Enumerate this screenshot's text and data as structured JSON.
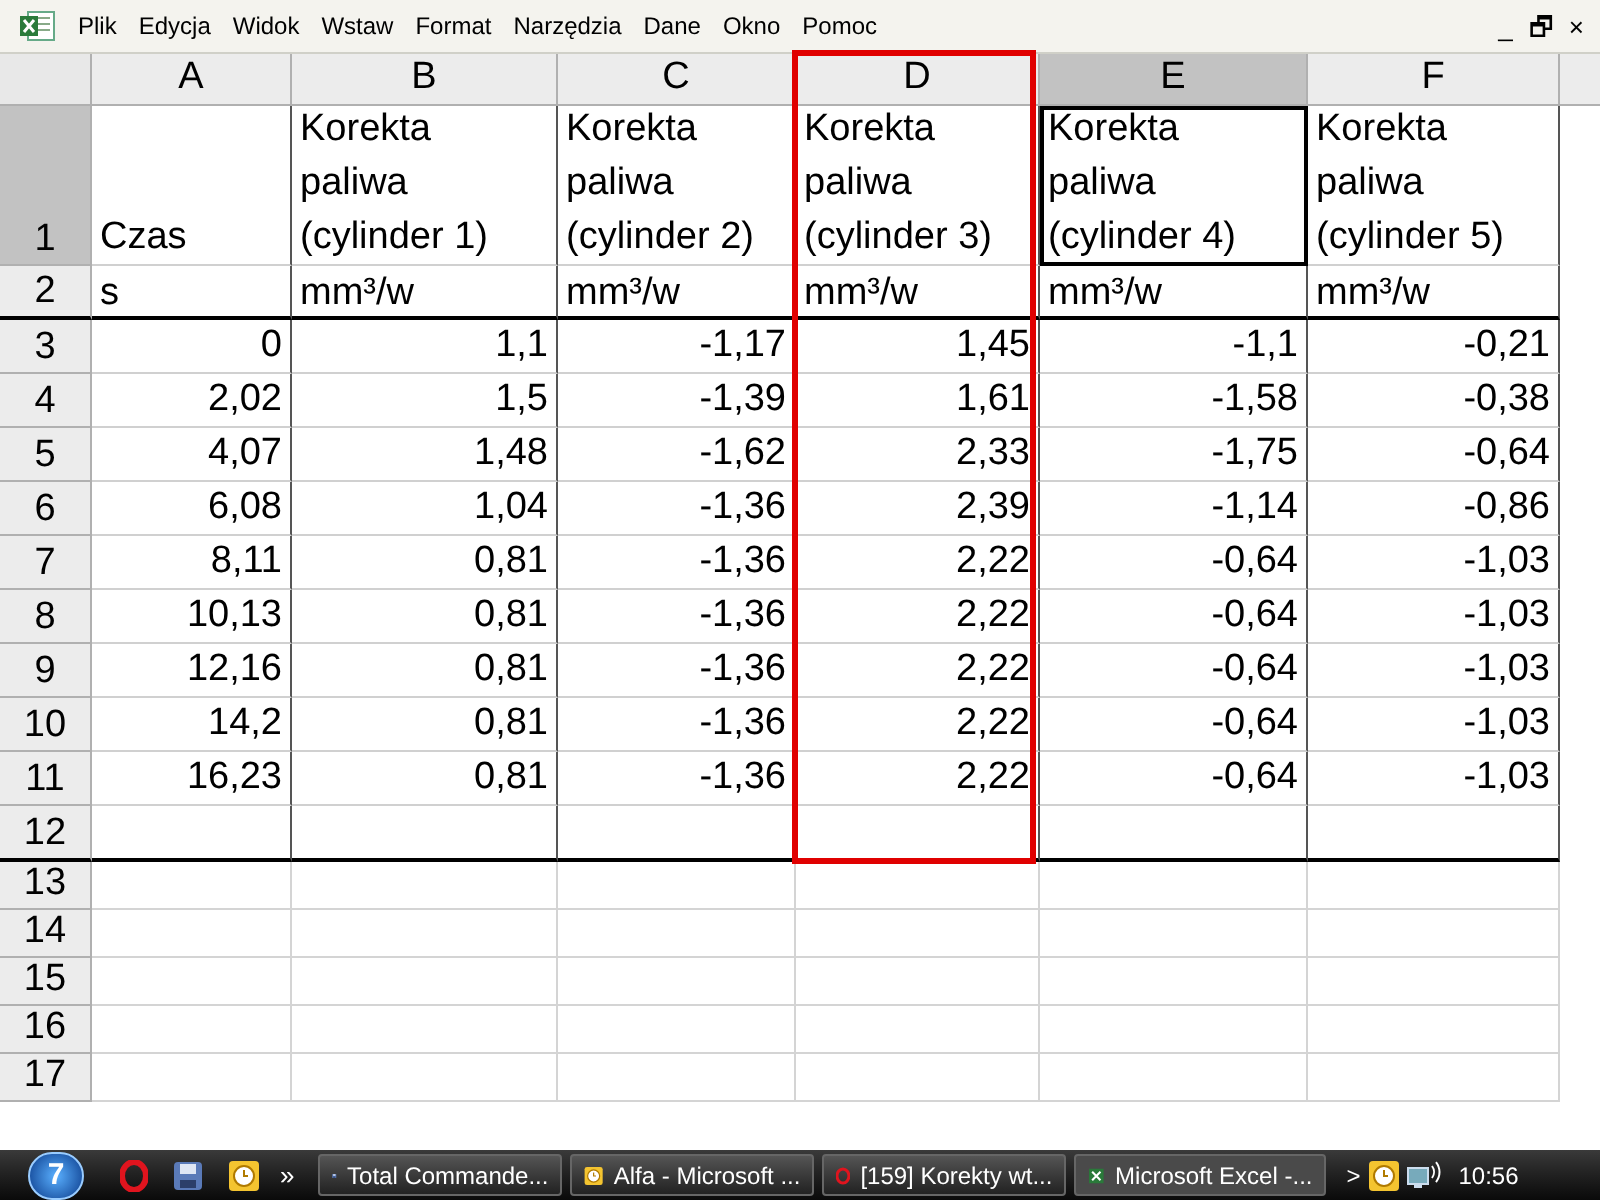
{
  "menu": [
    "Plik",
    "Edycja",
    "Widok",
    "Wstaw",
    "Format",
    "Narzędzia",
    "Dane",
    "Okno",
    "Pomoc"
  ],
  "window_controls": [
    "_",
    "🗗",
    "×"
  ],
  "columns": [
    {
      "letter": "A",
      "selected": false
    },
    {
      "letter": "B",
      "selected": false
    },
    {
      "letter": "C",
      "selected": false
    },
    {
      "letter": "D",
      "selected": false
    },
    {
      "letter": "E",
      "selected": true
    },
    {
      "letter": "F",
      "selected": false
    }
  ],
  "rows": [
    {
      "header": "1",
      "selected": true,
      "kind": "title",
      "cells": [
        "Czas",
        "Korekta paliwa (cylinder 1)",
        "Korekta paliwa (cylinder 2)",
        "Korekta paliwa (cylinder 3)",
        "Korekta paliwa (cylinder 4)",
        "Korekta paliwa (cylinder 5)"
      ]
    },
    {
      "header": "2",
      "selected": false,
      "kind": "unit",
      "cells": [
        "s",
        "mm³/w",
        "mm³/w",
        "mm³/w",
        "mm³/w",
        "mm³/w"
      ]
    },
    {
      "header": "3",
      "selected": false,
      "kind": "number",
      "cells": [
        "0",
        "1,1",
        "-1,17",
        "1,45",
        "-1,1",
        "-0,21"
      ]
    },
    {
      "header": "4",
      "selected": false,
      "kind": "number",
      "cells": [
        "2,02",
        "1,5",
        "-1,39",
        "1,61",
        "-1,58",
        "-0,38"
      ]
    },
    {
      "header": "5",
      "selected": false,
      "kind": "number",
      "cells": [
        "4,07",
        "1,48",
        "-1,62",
        "2,33",
        "-1,75",
        "-0,64"
      ]
    },
    {
      "header": "6",
      "selected": false,
      "kind": "number",
      "cells": [
        "6,08",
        "1,04",
        "-1,36",
        "2,39",
        "-1,14",
        "-0,86"
      ]
    },
    {
      "header": "7",
      "selected": false,
      "kind": "number",
      "cells": [
        "8,11",
        "0,81",
        "-1,36",
        "2,22",
        "-0,64",
        "-1,03"
      ]
    },
    {
      "header": "8",
      "selected": false,
      "kind": "number",
      "cells": [
        "10,13",
        "0,81",
        "-1,36",
        "2,22",
        "-0,64",
        "-1,03"
      ]
    },
    {
      "header": "9",
      "selected": false,
      "kind": "number",
      "cells": [
        "12,16",
        "0,81",
        "-1,36",
        "2,22",
        "-0,64",
        "-1,03"
      ]
    },
    {
      "header": "10",
      "selected": false,
      "kind": "number",
      "cells": [
        "14,2",
        "0,81",
        "-1,36",
        "2,22",
        "-0,64",
        "-1,03"
      ]
    },
    {
      "header": "11",
      "selected": false,
      "kind": "number",
      "cells": [
        "16,23",
        "0,81",
        "-1,36",
        "2,22",
        "-0,64",
        "-1,03"
      ]
    },
    {
      "header": "12",
      "selected": false,
      "kind": "last"
    },
    {
      "header": "13",
      "selected": false,
      "kind": "empty"
    },
    {
      "header": "14",
      "selected": false,
      "kind": "empty"
    },
    {
      "header": "15",
      "selected": false,
      "kind": "empty"
    },
    {
      "header": "16",
      "selected": false,
      "kind": "empty"
    },
    {
      "header": "17",
      "selected": false,
      "kind": "empty"
    }
  ],
  "taskbar": {
    "start_label": "7",
    "more": "»",
    "tasks": [
      {
        "label": "Total Commande...",
        "selected": false
      },
      {
        "label": "Alfa - Microsoft ...",
        "selected": false
      },
      {
        "label": "[159] Korekty wt...",
        "selected": false
      },
      {
        "label": "Microsoft Excel -...",
        "selected": true
      }
    ],
    "tray_arrow": ">",
    "clock": "10:56"
  }
}
